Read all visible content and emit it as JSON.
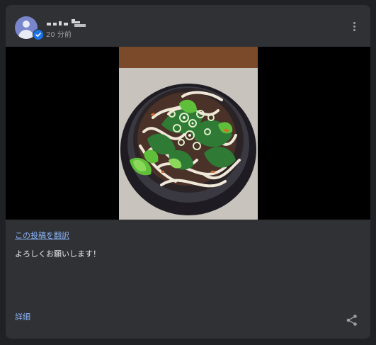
{
  "post": {
    "timestamp": "20 分前",
    "translate_link": "この投稿を翻訳",
    "body_text": "よろしくお願いします！",
    "details_link": "詳細"
  },
  "icons": {
    "menu": "more-vert-icon",
    "share": "share-icon",
    "verified": "verified-badge-icon",
    "avatar": "default-avatar-icon"
  },
  "colors": {
    "card_bg": "#303134",
    "page_bg": "#202124",
    "link": "#8ab4f8",
    "text": "#e8eaed",
    "muted": "#9aa0a6",
    "avatar": "#7986cb",
    "verified": "#1a73e8"
  }
}
